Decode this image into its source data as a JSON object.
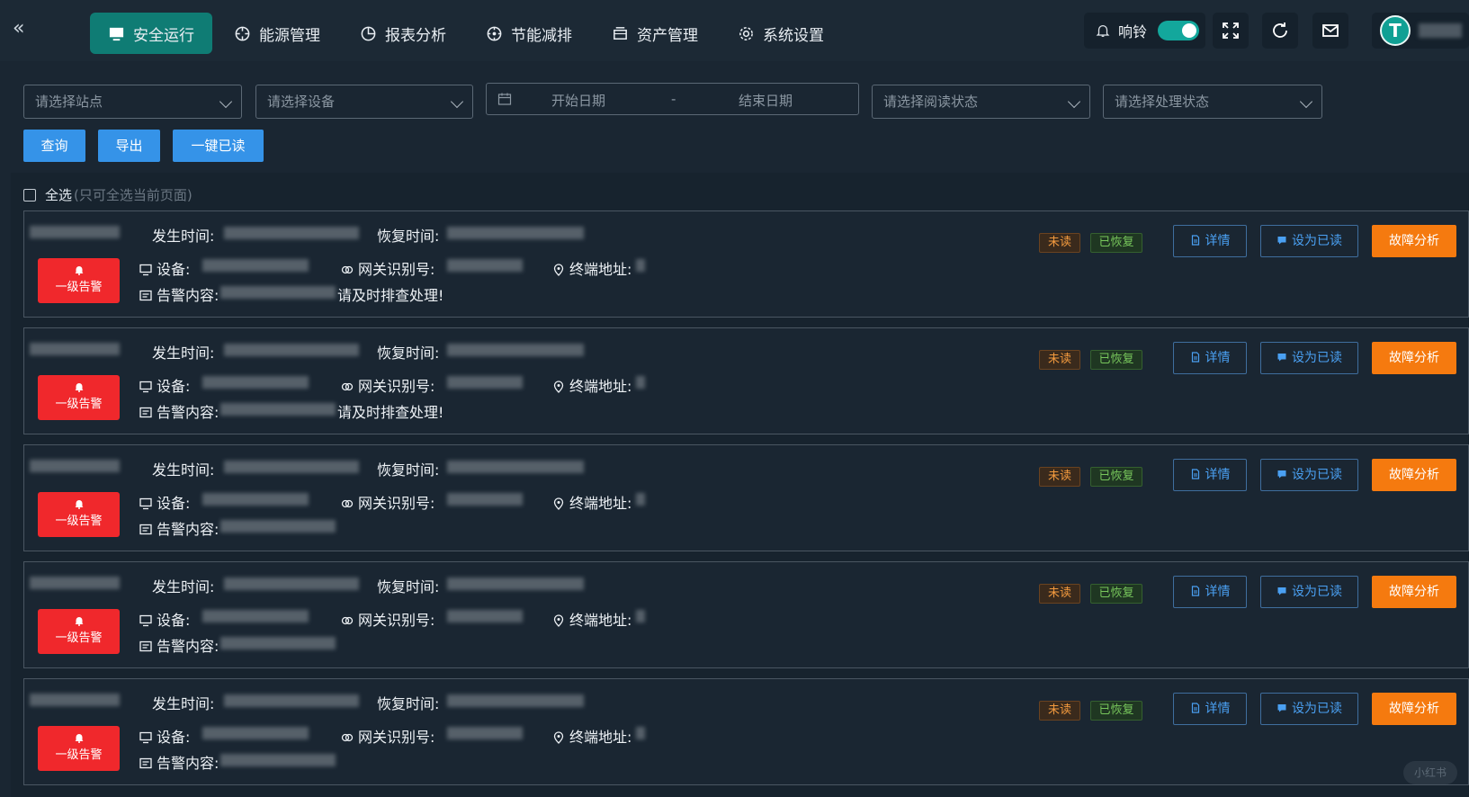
{
  "nav": {
    "items": [
      {
        "label": "安全运行",
        "icon": "monitor-icon",
        "active": true
      },
      {
        "label": "能源管理",
        "icon": "crosshair-icon"
      },
      {
        "label": "报表分析",
        "icon": "pie-chart-icon"
      },
      {
        "label": "节能减排",
        "icon": "target-icon"
      },
      {
        "label": "资产管理",
        "icon": "box-icon"
      },
      {
        "label": "系统设置",
        "icon": "gear-icon"
      }
    ]
  },
  "header": {
    "bell_label": "响铃",
    "bell_enabled": true,
    "avatar_letter": "T"
  },
  "filters": {
    "station_placeholder": "请选择站点",
    "device_placeholder": "请选择设备",
    "start_date_placeholder": "开始日期",
    "date_separator": "-",
    "end_date_placeholder": "结束日期",
    "read_status_placeholder": "请选择阅读状态",
    "handle_status_placeholder": "请选择处理状态"
  },
  "buttons": {
    "query": "查询",
    "export": "导出",
    "mark_all_read": "一键已读"
  },
  "select_all": {
    "label": "全选",
    "hint": "(只可全选当前页面)"
  },
  "card_labels": {
    "occur_time": "发生时间:",
    "recover_time": "恢复时间:",
    "device": "设备:",
    "gateway_id": "网关识别号:",
    "terminal_address": "终端地址:",
    "alarm_content": "告警内容:",
    "level": "一级告警",
    "unread": "未读",
    "recovered": "已恢复",
    "detail": "详情",
    "set_read": "设为已读",
    "fault_analysis": "故障分析"
  },
  "alarms": [
    {
      "content_suffix": "请及时排查处理!"
    },
    {
      "content_suffix": "请及时排查处理!"
    },
    {
      "content_suffix": ""
    },
    {
      "content_suffix": ""
    },
    {
      "content_suffix": ""
    }
  ],
  "colors": {
    "active_nav": "#0f7c74",
    "primary_button": "#3593e8",
    "level_badge": "#f0282c",
    "analyze_button": "#f57a0f",
    "unread_tag": "#f39a3e",
    "recovered_tag": "#78c75c"
  },
  "watermark": "小红书"
}
